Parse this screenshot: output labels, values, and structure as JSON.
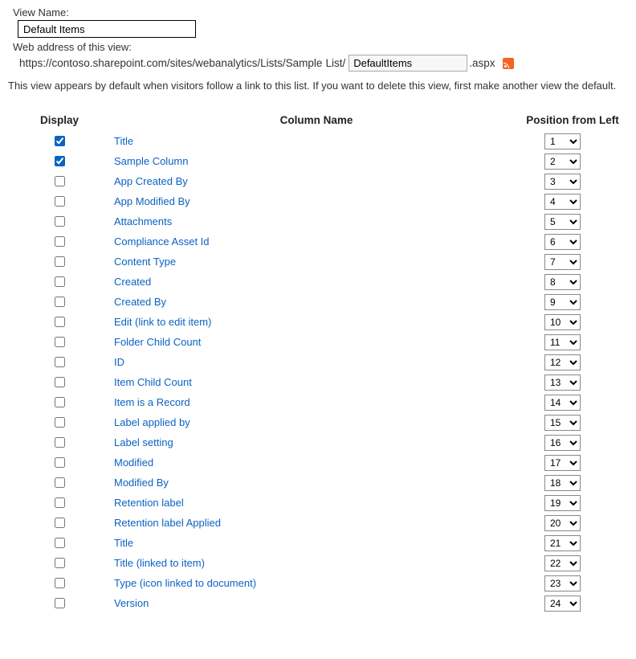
{
  "header": {
    "viewNameLabel": "View Name:",
    "viewNameValue": "Default Items",
    "webAddressLabel": "Web address of this view:",
    "urlPrefix": "https://contoso.sharepoint.com/sites/webanalytics/Lists/Sample",
    "urlListPart": "List/",
    "urlInputValue": "DefaultItems",
    "urlSuffix": ".aspx"
  },
  "description": "This view appears by default when visitors follow a link to this list. If you want to delete this view, first make another view the default.",
  "tableHeaders": {
    "display": "Display",
    "columnName": "Column Name",
    "position": "Position from Left"
  },
  "columns": [
    {
      "checked": true,
      "name": "Title",
      "position": 1
    },
    {
      "checked": true,
      "name": "Sample Column",
      "position": 2
    },
    {
      "checked": false,
      "name": "App Created By",
      "position": 3
    },
    {
      "checked": false,
      "name": "App Modified By",
      "position": 4
    },
    {
      "checked": false,
      "name": "Attachments",
      "position": 5
    },
    {
      "checked": false,
      "name": "Compliance Asset Id",
      "position": 6
    },
    {
      "checked": false,
      "name": "Content Type",
      "position": 7
    },
    {
      "checked": false,
      "name": "Created",
      "position": 8
    },
    {
      "checked": false,
      "name": "Created By",
      "position": 9
    },
    {
      "checked": false,
      "name": "Edit (link to edit item)",
      "position": 10
    },
    {
      "checked": false,
      "name": "Folder Child Count",
      "position": 11
    },
    {
      "checked": false,
      "name": "ID",
      "position": 12
    },
    {
      "checked": false,
      "name": "Item Child Count",
      "position": 13
    },
    {
      "checked": false,
      "name": "Item is a Record",
      "position": 14
    },
    {
      "checked": false,
      "name": "Label applied by",
      "position": 15
    },
    {
      "checked": false,
      "name": "Label setting",
      "position": 16
    },
    {
      "checked": false,
      "name": "Modified",
      "position": 17
    },
    {
      "checked": false,
      "name": "Modified By",
      "position": 18
    },
    {
      "checked": false,
      "name": "Retention label",
      "position": 19
    },
    {
      "checked": false,
      "name": "Retention label Applied",
      "position": 20
    },
    {
      "checked": false,
      "name": "Title",
      "position": 21
    },
    {
      "checked": false,
      "name": "Title (linked to item)",
      "position": 22
    },
    {
      "checked": false,
      "name": "Type (icon linked to document)",
      "position": 23
    },
    {
      "checked": false,
      "name": "Version",
      "position": 24
    }
  ],
  "maxPosition": 24
}
